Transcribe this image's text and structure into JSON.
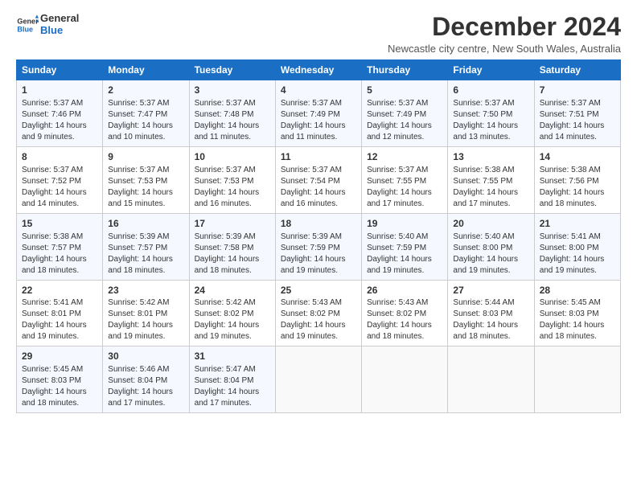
{
  "logo": {
    "line1": "General",
    "line2": "Blue"
  },
  "title": "December 2024",
  "location": "Newcastle city centre, New South Wales, Australia",
  "weekdays": [
    "Sunday",
    "Monday",
    "Tuesday",
    "Wednesday",
    "Thursday",
    "Friday",
    "Saturday"
  ],
  "weeks": [
    [
      {
        "day": "1",
        "rise": "5:37 AM",
        "set": "7:46 PM",
        "daylight": "14 hours and 9 minutes."
      },
      {
        "day": "2",
        "rise": "5:37 AM",
        "set": "7:47 PM",
        "daylight": "14 hours and 10 minutes."
      },
      {
        "day": "3",
        "rise": "5:37 AM",
        "set": "7:48 PM",
        "daylight": "14 hours and 11 minutes."
      },
      {
        "day": "4",
        "rise": "5:37 AM",
        "set": "7:49 PM",
        "daylight": "14 hours and 11 minutes."
      },
      {
        "day": "5",
        "rise": "5:37 AM",
        "set": "7:49 PM",
        "daylight": "14 hours and 12 minutes."
      },
      {
        "day": "6",
        "rise": "5:37 AM",
        "set": "7:50 PM",
        "daylight": "14 hours and 13 minutes."
      },
      {
        "day": "7",
        "rise": "5:37 AM",
        "set": "7:51 PM",
        "daylight": "14 hours and 14 minutes."
      }
    ],
    [
      {
        "day": "8",
        "rise": "5:37 AM",
        "set": "7:52 PM",
        "daylight": "14 hours and 14 minutes."
      },
      {
        "day": "9",
        "rise": "5:37 AM",
        "set": "7:53 PM",
        "daylight": "14 hours and 15 minutes."
      },
      {
        "day": "10",
        "rise": "5:37 AM",
        "set": "7:53 PM",
        "daylight": "14 hours and 16 minutes."
      },
      {
        "day": "11",
        "rise": "5:37 AM",
        "set": "7:54 PM",
        "daylight": "14 hours and 16 minutes."
      },
      {
        "day": "12",
        "rise": "5:37 AM",
        "set": "7:55 PM",
        "daylight": "14 hours and 17 minutes."
      },
      {
        "day": "13",
        "rise": "5:38 AM",
        "set": "7:55 PM",
        "daylight": "14 hours and 17 minutes."
      },
      {
        "day": "14",
        "rise": "5:38 AM",
        "set": "7:56 PM",
        "daylight": "14 hours and 18 minutes."
      }
    ],
    [
      {
        "day": "15",
        "rise": "5:38 AM",
        "set": "7:57 PM",
        "daylight": "14 hours and 18 minutes."
      },
      {
        "day": "16",
        "rise": "5:39 AM",
        "set": "7:57 PM",
        "daylight": "14 hours and 18 minutes."
      },
      {
        "day": "17",
        "rise": "5:39 AM",
        "set": "7:58 PM",
        "daylight": "14 hours and 18 minutes."
      },
      {
        "day": "18",
        "rise": "5:39 AM",
        "set": "7:59 PM",
        "daylight": "14 hours and 19 minutes."
      },
      {
        "day": "19",
        "rise": "5:40 AM",
        "set": "7:59 PM",
        "daylight": "14 hours and 19 minutes."
      },
      {
        "day": "20",
        "rise": "5:40 AM",
        "set": "8:00 PM",
        "daylight": "14 hours and 19 minutes."
      },
      {
        "day": "21",
        "rise": "5:41 AM",
        "set": "8:00 PM",
        "daylight": "14 hours and 19 minutes."
      }
    ],
    [
      {
        "day": "22",
        "rise": "5:41 AM",
        "set": "8:01 PM",
        "daylight": "14 hours and 19 minutes."
      },
      {
        "day": "23",
        "rise": "5:42 AM",
        "set": "8:01 PM",
        "daylight": "14 hours and 19 minutes."
      },
      {
        "day": "24",
        "rise": "5:42 AM",
        "set": "8:02 PM",
        "daylight": "14 hours and 19 minutes."
      },
      {
        "day": "25",
        "rise": "5:43 AM",
        "set": "8:02 PM",
        "daylight": "14 hours and 19 minutes."
      },
      {
        "day": "26",
        "rise": "5:43 AM",
        "set": "8:02 PM",
        "daylight": "14 hours and 18 minutes."
      },
      {
        "day": "27",
        "rise": "5:44 AM",
        "set": "8:03 PM",
        "daylight": "14 hours and 18 minutes."
      },
      {
        "day": "28",
        "rise": "5:45 AM",
        "set": "8:03 PM",
        "daylight": "14 hours and 18 minutes."
      }
    ],
    [
      {
        "day": "29",
        "rise": "5:45 AM",
        "set": "8:03 PM",
        "daylight": "14 hours and 18 minutes."
      },
      {
        "day": "30",
        "rise": "5:46 AM",
        "set": "8:04 PM",
        "daylight": "14 hours and 17 minutes."
      },
      {
        "day": "31",
        "rise": "5:47 AM",
        "set": "8:04 PM",
        "daylight": "14 hours and 17 minutes."
      },
      null,
      null,
      null,
      null
    ]
  ],
  "labels": {
    "sunrise": "Sunrise:",
    "sunset": "Sunset:",
    "daylight": "Daylight:"
  }
}
